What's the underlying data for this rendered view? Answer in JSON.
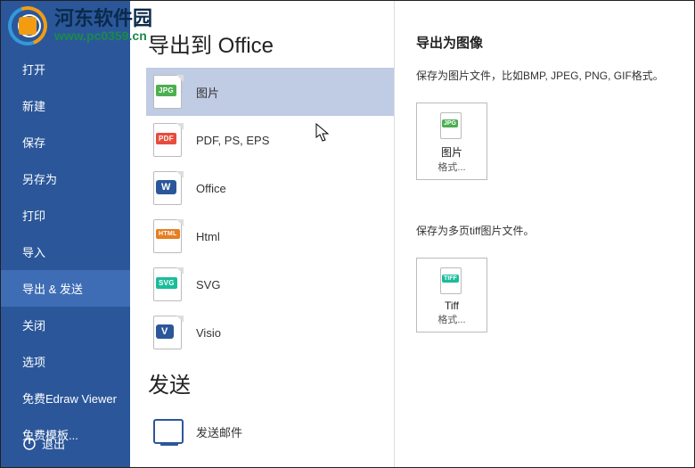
{
  "watermark": {
    "title": "河东软件园",
    "sub": "www.pc0359.cn"
  },
  "sidebar": {
    "items": [
      {
        "label": "打开"
      },
      {
        "label": "新建"
      },
      {
        "label": "保存"
      },
      {
        "label": "另存为"
      },
      {
        "label": "打印"
      },
      {
        "label": "导入"
      },
      {
        "label": "导出 & 发送"
      },
      {
        "label": "关闭"
      },
      {
        "label": "选项"
      },
      {
        "label": "免费Edraw Viewer"
      },
      {
        "label": "免费模板..."
      }
    ],
    "exit": "退出"
  },
  "export": {
    "title": "导出到 Office",
    "options": [
      {
        "label": "图片",
        "badge": "JPG"
      },
      {
        "label": "PDF, PS, EPS",
        "badge": "PDF"
      },
      {
        "label": "Office",
        "badge": "W"
      },
      {
        "label": "Html",
        "badge": "HTML"
      },
      {
        "label": "SVG",
        "badge": "SVG"
      },
      {
        "label": "Visio",
        "badge": "V"
      }
    ]
  },
  "send": {
    "title": "发送",
    "option": {
      "label": "发送邮件"
    }
  },
  "detail": {
    "title": "导出为图像",
    "desc1": "保存为图片文件，比如BMP, JPEG, PNG, GIF格式。",
    "btn1": {
      "cap1": "图片",
      "cap2": "格式..."
    },
    "desc2": "保存为多页tiff图片文件。",
    "btn2": {
      "cap1": "Tiff",
      "cap2": "格式..."
    }
  }
}
